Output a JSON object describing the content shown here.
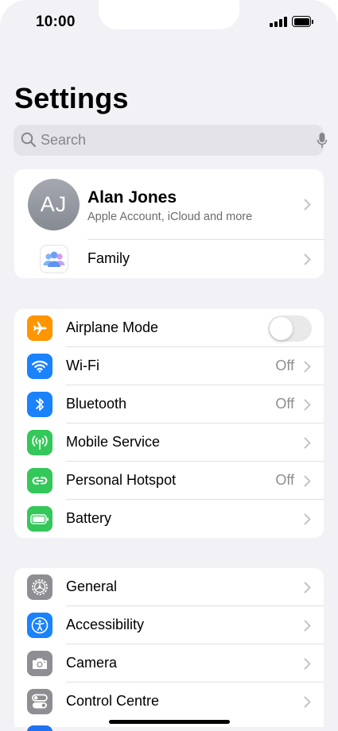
{
  "status_bar": {
    "time": "10:00",
    "signal_icon": "cellular-signal-icon",
    "battery_icon": "battery-icon"
  },
  "header": {
    "title": "Settings"
  },
  "search": {
    "placeholder": "Search",
    "value": ""
  },
  "account": {
    "initials": "AJ",
    "name": "Alan Jones",
    "subtitle": "Apple Account, iCloud and more",
    "family_label": "Family"
  },
  "connectivity": {
    "items": [
      {
        "label": "Airplane Mode",
        "value": "",
        "icon": "airplane-icon",
        "color": "#ff9500",
        "toggle": false
      },
      {
        "label": "Wi-Fi",
        "value": "Off",
        "icon": "wifi-icon",
        "color": "#1a82fb"
      },
      {
        "label": "Bluetooth",
        "value": "Off",
        "icon": "bluetooth-icon",
        "color": "#1a82fb"
      },
      {
        "label": "Mobile Service",
        "value": "",
        "icon": "antenna-icon",
        "color": "#34c759"
      },
      {
        "label": "Personal Hotspot",
        "value": "Off",
        "icon": "hotspot-icon",
        "color": "#34c759"
      },
      {
        "label": "Battery",
        "value": "",
        "icon": "battery-setting-icon",
        "color": "#34c759"
      }
    ]
  },
  "general_group": {
    "items": [
      {
        "label": "General",
        "icon": "gear-icon",
        "color": "#8e8e93"
      },
      {
        "label": "Accessibility",
        "icon": "accessibility-icon",
        "color": "#1a82fb"
      },
      {
        "label": "Camera",
        "icon": "camera-icon",
        "color": "#8e8e93"
      },
      {
        "label": "Control Centre",
        "icon": "control-centre-icon",
        "color": "#8e8e93"
      }
    ]
  }
}
